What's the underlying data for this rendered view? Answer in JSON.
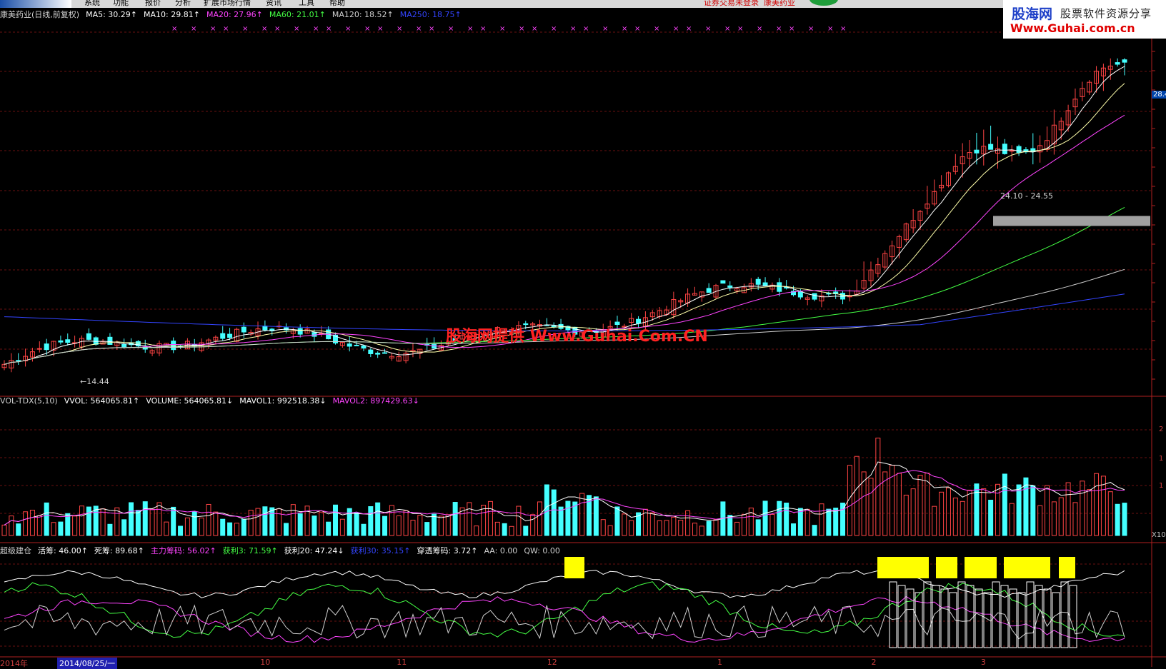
{
  "menu": {
    "items": [
      "系统",
      "功能",
      "报价",
      "分析",
      "扩展市场行情",
      "资讯",
      "工具",
      "帮助"
    ],
    "status_text": "证券交易未登录",
    "stock_short": "康美药业"
  },
  "watermark_box": {
    "site": "股海网",
    "slogan": "股票软件资源分享",
    "url": "Www.Guhai.com.cn"
  },
  "watermark_center": "股海网提供 Www.Guhai.Com.CN",
  "main_legend": [
    {
      "text": "康美药业(日线,前复权)",
      "color": "#d0d0d0"
    },
    {
      "text": "MA5: 30.29↑",
      "color": "#ffffff"
    },
    {
      "text": "MA10: 29.81↑",
      "color": "#ffffff"
    },
    {
      "text": "MA20: 27.96↑",
      "color": "#ff44ff"
    },
    {
      "text": "MA60: 21.01↑",
      "color": "#44ff44"
    },
    {
      "text": "MA120: 18.52↑",
      "color": "#d0d0d0"
    },
    {
      "text": "MA250: 18.75↑",
      "color": "#3344ff"
    }
  ],
  "volume_legend": [
    {
      "text": "VOL-TDX(5,10)",
      "color": "#d0d0d0"
    },
    {
      "text": "VVOL: 564065.81↑",
      "color": "#ffffff"
    },
    {
      "text": "VOLUME: 564065.81↓",
      "color": "#ffffff"
    },
    {
      "text": "MAVOL1: 992518.38↓",
      "color": "#ffffff"
    },
    {
      "text": "MAVOL2: 897429.63↓",
      "color": "#ff44ff"
    }
  ],
  "indicator_legend": [
    {
      "text": "超级建仓",
      "color": "#d0d0d0"
    },
    {
      "text": "活筹: 46.00↑",
      "color": "#ffffff"
    },
    {
      "text": "死筹: 89.68↑",
      "color": "#ffffff"
    },
    {
      "text": "主力筹码: 56.02↑",
      "color": "#ff44ff"
    },
    {
      "text": "获利3: 71.59↑",
      "color": "#44ff44"
    },
    {
      "text": "获利20: 47.24↓",
      "color": "#ffffff"
    },
    {
      "text": "获利30: 35.15↑",
      "color": "#3344ff"
    },
    {
      "text": "穿透筹码: 3.72↑",
      "color": "#ffffff"
    },
    {
      "text": "AA: 0.00",
      "color": "#d0d0d0"
    },
    {
      "text": "QW: 0.00",
      "color": "#d0d0d0"
    }
  ],
  "annotations": {
    "range_label": "24.10 - 24.55",
    "low_label": "←14.44",
    "last_price_tag": "28.4",
    "volume_unit": "X10"
  },
  "x_axis": {
    "labels": [
      {
        "text": "2014年",
        "pos": 0.0
      },
      {
        "text": "10",
        "pos": 0.222
      },
      {
        "text": "11",
        "pos": 0.339
      },
      {
        "text": "12",
        "pos": 0.468
      },
      {
        "text": "1",
        "pos": 0.614
      },
      {
        "text": "2",
        "pos": 0.746
      },
      {
        "text": "3",
        "pos": 0.84
      }
    ],
    "cursor_date": "2014/08/25/一"
  },
  "y_axis_volume_ticks": [
    "2",
    "1",
    "1"
  ],
  "chart_data": {
    "type": "candlestick",
    "title": "康美药业(日线,前复权)",
    "x_start": "2014-08",
    "x_end": "2015-03",
    "ylim": [
      13.5,
      36
    ],
    "price": {
      "low": 14.44,
      "shaded_range": [
        24.1,
        24.55
      ],
      "last_tag": 28.4
    },
    "moving_averages": [
      {
        "name": "MA5",
        "last": 30.29
      },
      {
        "name": "MA10",
        "last": 29.81
      },
      {
        "name": "MA20",
        "last": 27.96
      },
      {
        "name": "MA60",
        "last": 21.01
      },
      {
        "name": "MA120",
        "last": 18.52
      },
      {
        "name": "MA250",
        "last": 18.75
      }
    ],
    "volume": {
      "VVOL": 564065.81,
      "VOLUME": 564065.81,
      "MAVOL1": 992518.38,
      "MAVOL2": 897429.63
    },
    "indicator": {
      "活筹": 46.0,
      "死筹": 89.68,
      "主力筹码": 56.02,
      "获利3": 71.59,
      "获利20": 47.24,
      "获利30": 35.15,
      "穿透筹码": 3.72,
      "AA": 0.0,
      "QW": 0.0
    }
  }
}
